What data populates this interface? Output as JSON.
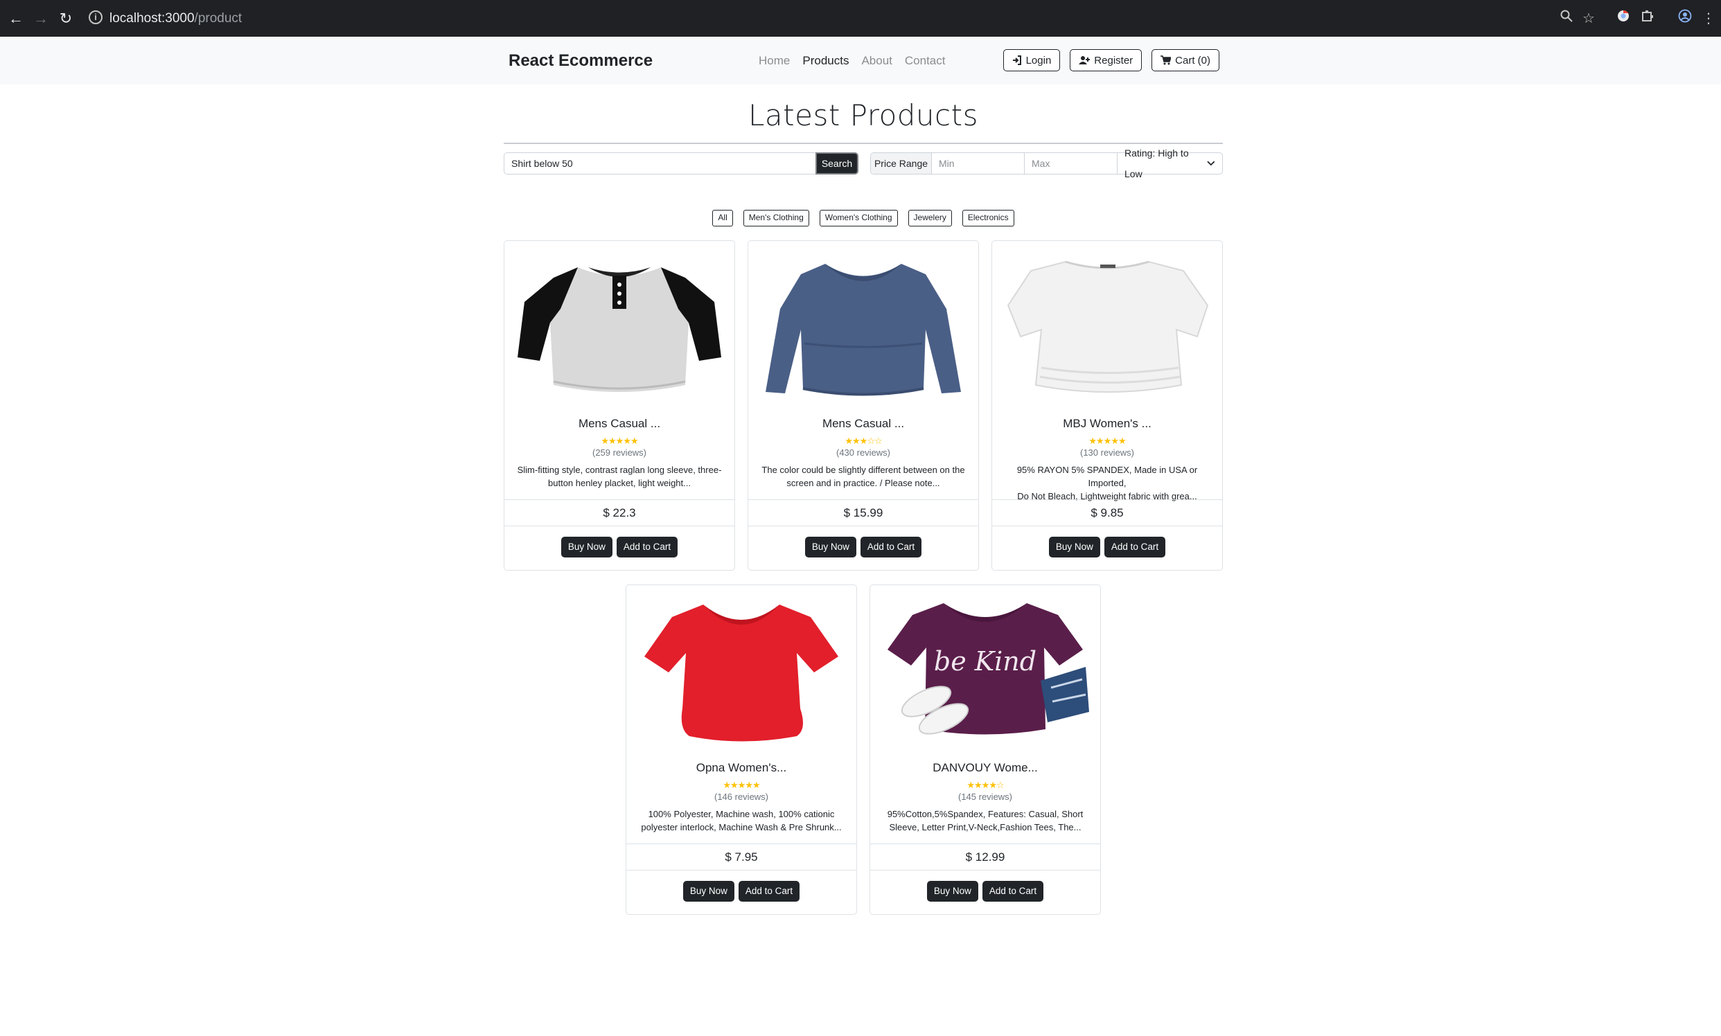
{
  "browser": {
    "url_host": "localhost:3000",
    "url_path": "/product"
  },
  "navbar": {
    "brand": "React Ecommerce",
    "links": [
      "Home",
      "Products",
      "About",
      "Contact"
    ],
    "active_link": "Products",
    "login_label": "Login",
    "register_label": "Register",
    "cart_label": "Cart (0)"
  },
  "page": {
    "title": "Latest Products"
  },
  "search": {
    "value": "Shirt below 50",
    "button_label": "Search"
  },
  "filter": {
    "range_label": "Price Range",
    "min_placeholder": "Min",
    "max_placeholder": "Max",
    "sort_value": "Rating: High to Low"
  },
  "categories": [
    "All",
    "Men's Clothing",
    "Women's Clothing",
    "Jewelery",
    "Electronics"
  ],
  "products": [
    {
      "name": "Mens Casual ...",
      "stars": "★★★★★",
      "reviews": "(259 reviews)",
      "desc_line1": "Slim-fitting style, contrast raglan long sleeve, three-",
      "desc_line2": "button henley placket, light weight...",
      "price": "$ 22.3",
      "buy_label": "Buy Now",
      "cart_label": "Add to Cart",
      "image": "henley-shirt-image"
    },
    {
      "name": "Mens Casual ...",
      "stars": "★★★☆☆",
      "reviews": "(430 reviews)",
      "desc_line1": "The color could be slightly different between on the",
      "desc_line2": "screen and in practice. / Please note...",
      "price": "$ 15.99",
      "buy_label": "Buy Now",
      "cart_label": "Add to Cart",
      "image": "long-sleeve-shirt-image"
    },
    {
      "name": "MBJ Women's ...",
      "stars": "★★★★★",
      "reviews": "(130 reviews)",
      "desc_line1": "95% RAYON 5% SPANDEX, Made in USA or Imported,",
      "desc_line2": "Do Not Bleach, Lightweight fabric with grea...",
      "price": "$ 9.85",
      "buy_label": "Buy Now",
      "cart_label": "Add to Cart",
      "image": "white-top-image"
    },
    {
      "name": "Opna Women's...",
      "stars": "★★★★★",
      "reviews": "(146 reviews)",
      "desc_line1": "100% Polyester, Machine wash, 100% cationic",
      "desc_line2": "polyester interlock, Machine Wash & Pre Shrunk...",
      "price": "$ 7.95",
      "buy_label": "Buy Now",
      "cart_label": "Add to Cart",
      "image": "red-tshirt-image"
    },
    {
      "name": "DANVOUY Wome...",
      "stars": "★★★★☆",
      "reviews": "(145 reviews)",
      "desc_line1": "95%Cotton,5%Spandex, Features: Casual, Short",
      "desc_line2": "Sleeve, Letter Print,V-Neck,Fashion Tees, The...",
      "price": "$ 12.99",
      "buy_label": "Buy Now",
      "cart_label": "Add to Cart",
      "image": "be-kind-tshirt-image",
      "image_text": "be Kind"
    }
  ],
  "colors": {
    "dark": "#212529",
    "star": "#ffc107",
    "navbar_bg": "#f8f9fa",
    "chrome_bg": "#202124"
  }
}
